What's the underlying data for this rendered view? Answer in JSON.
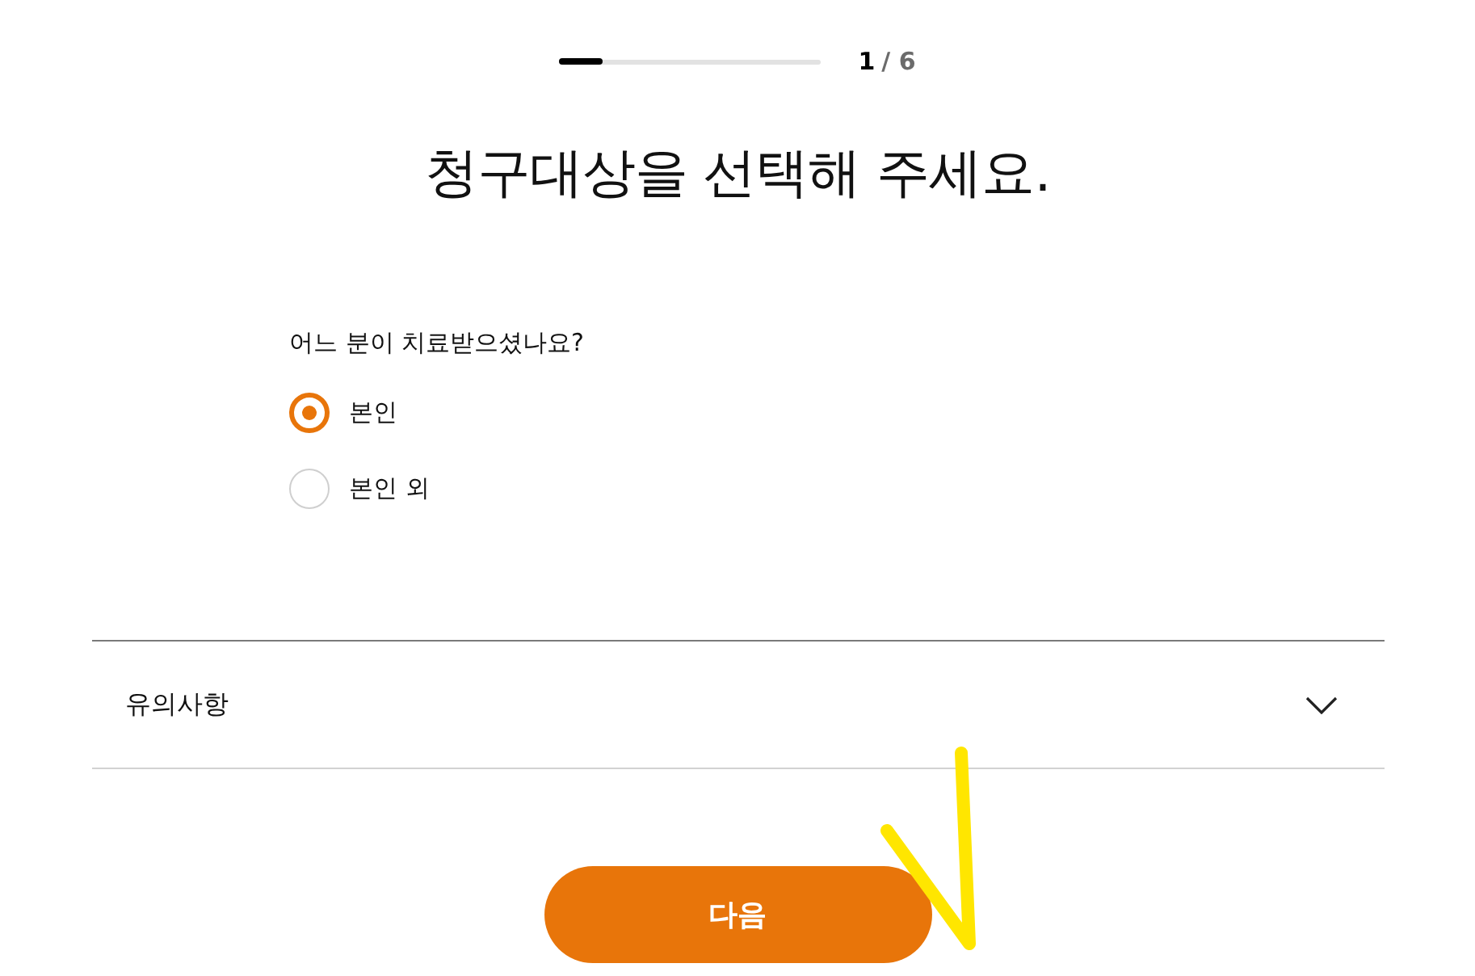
{
  "progress": {
    "level": 0.1667,
    "current": "1",
    "total": "/ 6"
  },
  "title": "청구대상을 선택해 주세요.",
  "question": "어느 분이 치료받으셨나요?",
  "options": [
    {
      "label": "본인",
      "selected": true
    },
    {
      "label": "본인 외",
      "selected": false
    }
  ],
  "notice": {
    "title": "유의사항",
    "expanded": false
  },
  "next_button": "다음",
  "annotation": {
    "kind": "checkmark"
  }
}
